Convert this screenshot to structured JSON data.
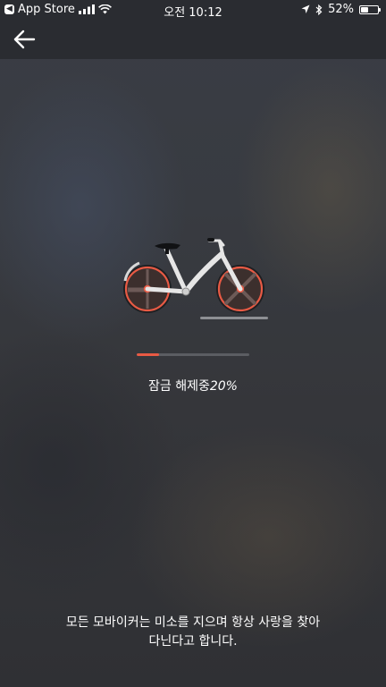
{
  "status_bar": {
    "back_app": "App Store",
    "time": "오전 10:12",
    "battery": "52%",
    "battery_level": 0.52
  },
  "nav": {
    "back_icon": "arrow-left-icon"
  },
  "unlock": {
    "label": "잠금 해제중",
    "percent": "20%",
    "progress": 0.2
  },
  "footer": {
    "line1": "모든 모바이커는 미소를 지으며 항상 사랑을 찾아",
    "line2": "다닌다고 합니다."
  },
  "colors": {
    "accent": "#e85a44",
    "background": "#2f3136",
    "bar": "#2a2c31"
  }
}
